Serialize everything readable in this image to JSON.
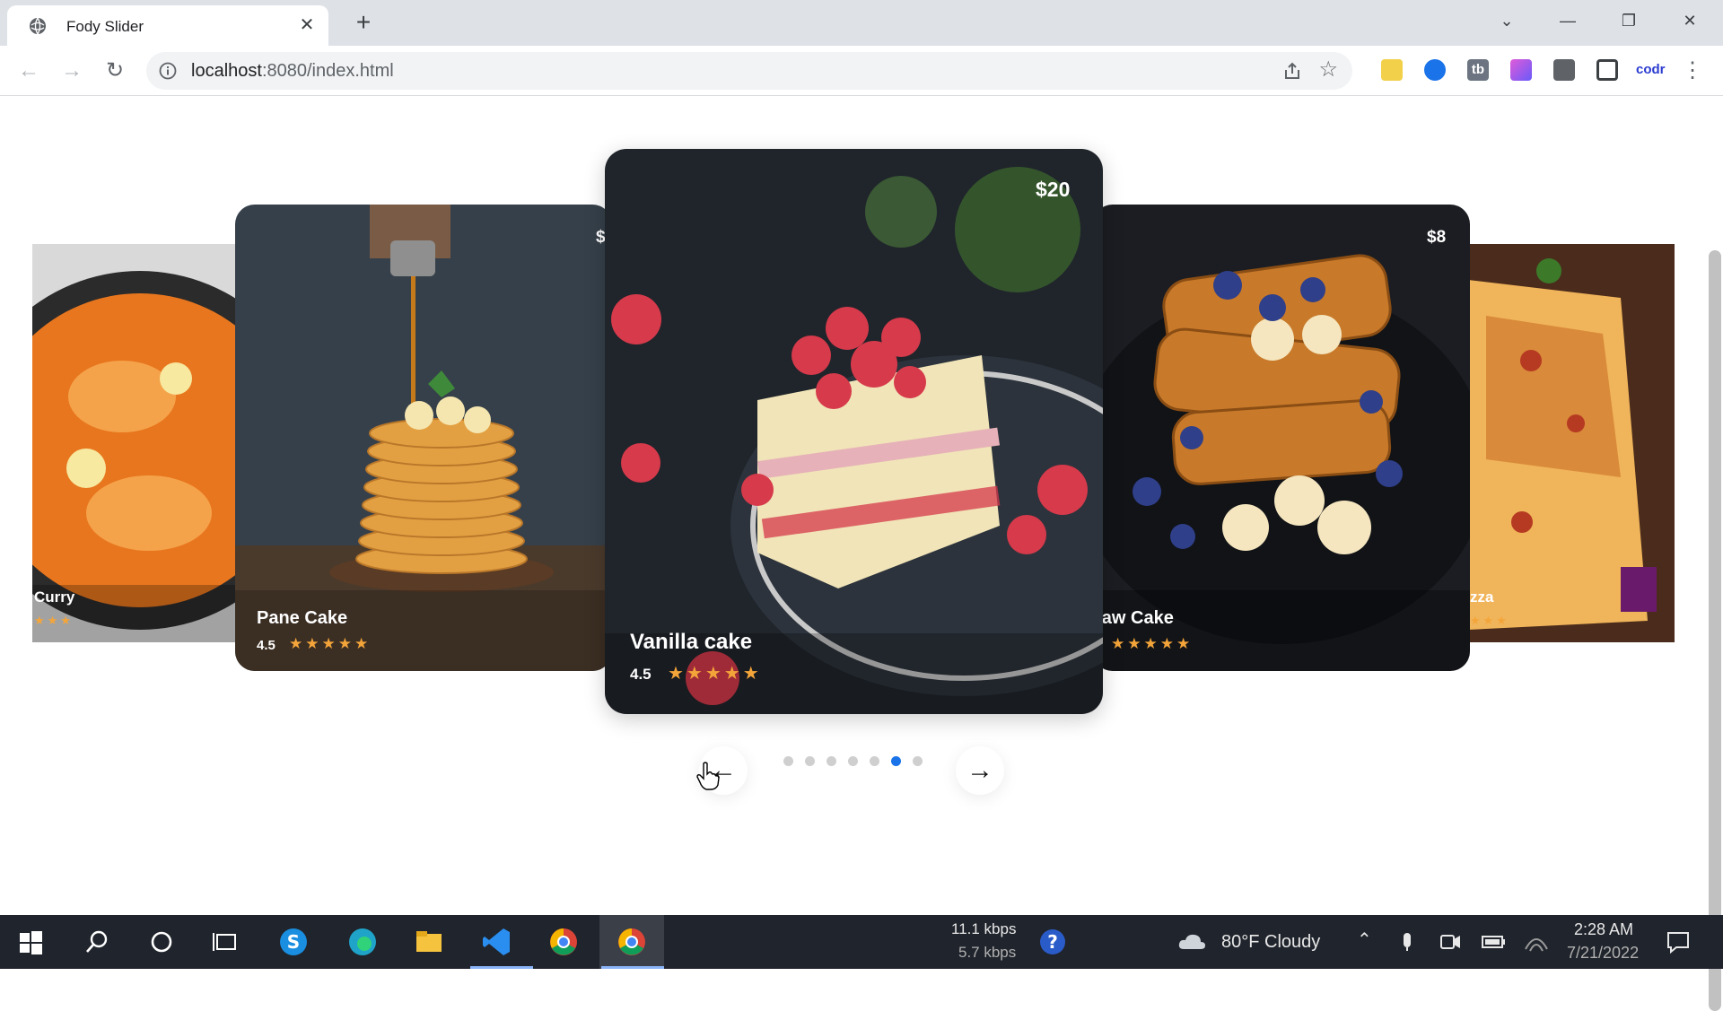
{
  "browser": {
    "tab_title": "Fody Slider",
    "tab_close_glyph": "✕",
    "new_tab_glyph": "+",
    "url_host": "localhost",
    "url_rest": ":8080/index.html",
    "back_glyph": "←",
    "forward_glyph": "→",
    "reload_glyph": "↻",
    "star_glyph": "☆",
    "menu_glyph": "⋮",
    "window_controls": {
      "dropdown": "⌄",
      "minimize": "—",
      "restore": "❐",
      "close": "✕"
    },
    "extensions": [
      "sheets-icon",
      "screen-recorder-icon",
      "tb-icon",
      "pen-icon",
      "puzzle-extension-icon",
      "side-panel-icon",
      "codr-icon"
    ],
    "ext_tb_label": "tb",
    "ext_codr_label": "codr"
  },
  "slider": {
    "cards": [
      {
        "name": "Curry",
        "rating": "",
        "price": "",
        "palette": [
          "#2b2b2b",
          "#e8761e",
          "#f5a34b"
        ]
      },
      {
        "name": "Pane Cake",
        "rating": "4.5",
        "price": "$",
        "palette": [
          "#36404a",
          "#c98a2e",
          "#f0b85a"
        ]
      },
      {
        "name": "Vanilla cake",
        "rating": "4.5",
        "price": "$20",
        "palette": [
          "#20252b",
          "#f1e4b8",
          "#d63a4b"
        ]
      },
      {
        "name": "raw Cake",
        "rating": "",
        "price": "$8",
        "palette": [
          "#1b1d22",
          "#c87a2a",
          "#2f3f8a"
        ]
      },
      {
        "name": "zza",
        "rating": "",
        "price": "",
        "palette": [
          "#4b2c1c",
          "#f0b45a",
          "#b63a22"
        ]
      }
    ],
    "stars": "★★★★★",
    "partial_stars": "★★★",
    "rating_value": 4.5,
    "dots_total": 7,
    "active_dot": 6,
    "prev_glyph": "←",
    "next_glyph": "→"
  },
  "taskbar": {
    "net_up": "11.1 kbps",
    "net_down": "5.7 kbps",
    "weather": "80°F  Cloudy",
    "time": "2:28 AM",
    "date": "7/21/2022",
    "apps": [
      "start-icon",
      "search-icon",
      "cortana-icon",
      "task-view-icon",
      "skype-icon",
      "edge-icon",
      "file-explorer-icon",
      "vscode-icon",
      "chrome-icon",
      "chrome-active-icon"
    ]
  }
}
